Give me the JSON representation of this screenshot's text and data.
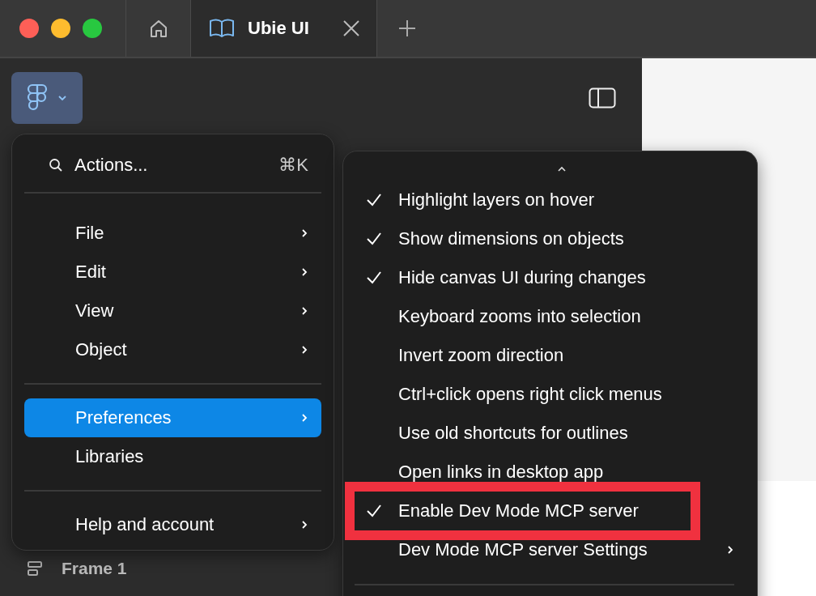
{
  "tabs": [
    {
      "kind": "home",
      "selected": false
    },
    {
      "kind": "file",
      "label": "Ubie UI",
      "selected": true,
      "closable": true
    }
  ],
  "main_menu": {
    "search": {
      "label": "Actions...",
      "shortcut": "⌘K"
    },
    "groups": [
      [
        {
          "label": "File",
          "submenu": true,
          "selected": false
        },
        {
          "label": "Edit",
          "submenu": true,
          "selected": false
        },
        {
          "label": "View",
          "submenu": true,
          "selected": false
        },
        {
          "label": "Object",
          "submenu": true,
          "selected": false
        }
      ],
      [
        {
          "label": "Preferences",
          "submenu": true,
          "selected": true
        },
        {
          "label": "Libraries",
          "submenu": false,
          "selected": false
        }
      ],
      [
        {
          "label": "Help and account",
          "submenu": true,
          "selected": false
        }
      ]
    ]
  },
  "preferences_menu": {
    "items": [
      {
        "label": "Highlight layers on hover",
        "checked": true,
        "submenu": false,
        "annotated": false
      },
      {
        "label": "Show dimensions on objects",
        "checked": true,
        "submenu": false,
        "annotated": false
      },
      {
        "label": "Hide canvas UI during changes",
        "checked": true,
        "submenu": false,
        "annotated": false
      },
      {
        "label": "Keyboard zooms into selection",
        "checked": false,
        "submenu": false,
        "annotated": false
      },
      {
        "label": "Invert zoom direction",
        "checked": false,
        "submenu": false,
        "annotated": false
      },
      {
        "label": "Ctrl+click opens right click menus",
        "checked": false,
        "submenu": false,
        "annotated": false
      },
      {
        "label": "Use old shortcuts for outlines",
        "checked": false,
        "submenu": false,
        "annotated": false
      },
      {
        "label": "Open links in desktop app",
        "checked": false,
        "submenu": false,
        "annotated": false
      },
      {
        "label": "Enable Dev Mode MCP server",
        "checked": true,
        "submenu": false,
        "annotated": true
      },
      {
        "label": "Dev Mode MCP server Settings",
        "checked": false,
        "submenu": true,
        "annotated": false
      }
    ]
  },
  "layers": [
    {
      "label": "Frame 1",
      "kind": "frame"
    }
  ]
}
